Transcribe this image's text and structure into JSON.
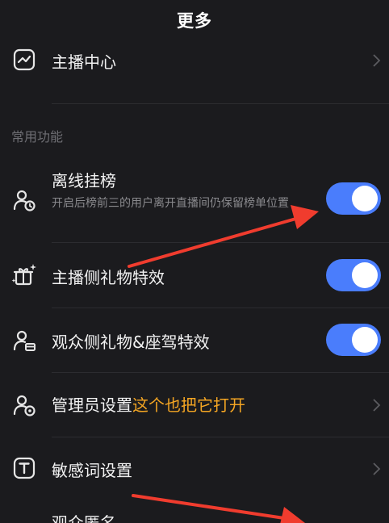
{
  "header": {
    "title": "更多"
  },
  "top_item": {
    "label": "主播中心",
    "icon": "chart-box-icon"
  },
  "section": {
    "label": "常用功能"
  },
  "items": [
    {
      "label": "离线挂榜",
      "description": "开启后榜前三的用户离开直播间仍保留榜单位置",
      "icon": "user-clock-icon",
      "control": "toggle",
      "enabled": true
    },
    {
      "label": "主播侧礼物特效",
      "icon": "gift-sparkle-icon",
      "control": "toggle",
      "enabled": true
    },
    {
      "label": "观众侧礼物&座驾特效",
      "icon": "user-gift-icon",
      "control": "toggle",
      "enabled": true
    },
    {
      "label": "管理员设置",
      "icon": "user-gear-icon",
      "control": "chevron"
    },
    {
      "label": "敏感词设置",
      "icon": "t-box-icon",
      "control": "chevron"
    },
    {
      "label": "观众匿名",
      "icon": "user-anonymous-icon",
      "control": "none"
    }
  ],
  "annotation": {
    "text": "这个也把它打开",
    "color": "#f5a623"
  },
  "colors": {
    "background": "#1b1b1e",
    "toggle_on": "#4a7dfc",
    "arrow": "#f03c2e"
  }
}
